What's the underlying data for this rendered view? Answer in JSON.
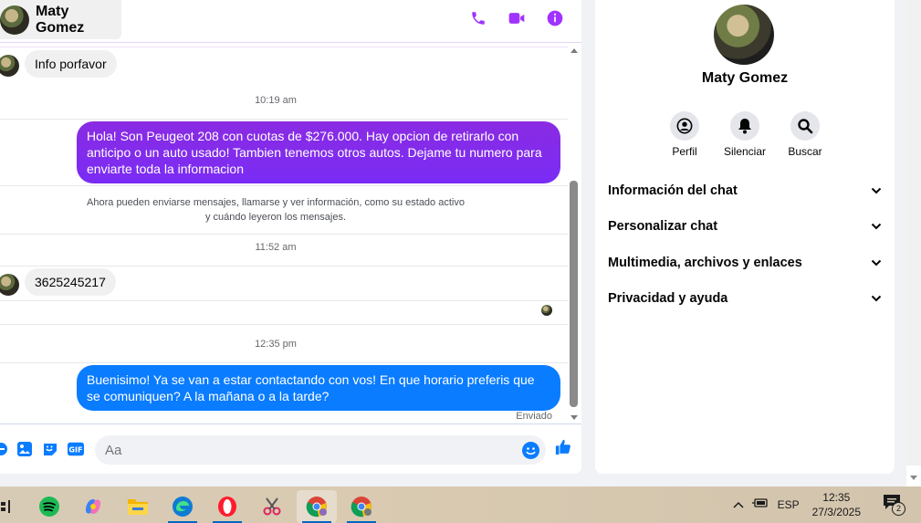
{
  "header": {
    "contact_name": "Maty Gomez"
  },
  "messages": {
    "first_in": "Info porfavor",
    "time1": "10:19 am",
    "out1": "Hola! Son Peugeot 208 con cuotas de $276.000. Hay opcion de retirarlo con anticipo o un auto usado! Tambien tenemos otros autos. Dejame tu numero para enviarte toda la informacion",
    "system_note_line1": "Ahora pueden enviarse mensajes, llamarse y ver información, como su estado activo",
    "system_note_line2": "y cuándo leyeron los mensajes.",
    "time2": "11:52 am",
    "in2": "3625245217",
    "time3": "12:35 pm",
    "out2": "Buenisimo! Ya se van a estar contactando con vos! En que horario preferis que se comuniquen? A la mañana o a la tarde?",
    "status": "Enviado"
  },
  "composer": {
    "placeholder": "Aa"
  },
  "info": {
    "name": "Maty Gomez",
    "actions": [
      "Perfil",
      "Silenciar",
      "Buscar"
    ],
    "sections": [
      "Información del chat",
      "Personalizar chat",
      "Multimedia, archivos y enlaces",
      "Privacidad y ayuda"
    ]
  },
  "taskbar": {
    "lang": "ESP",
    "time": "12:35",
    "date": "27/3/2025",
    "notif_count": "2"
  },
  "colors": {
    "accent_purple": "#a033ff",
    "bubble_blue": "#0a7cff",
    "bubble_purple": "#7d2cf0"
  }
}
